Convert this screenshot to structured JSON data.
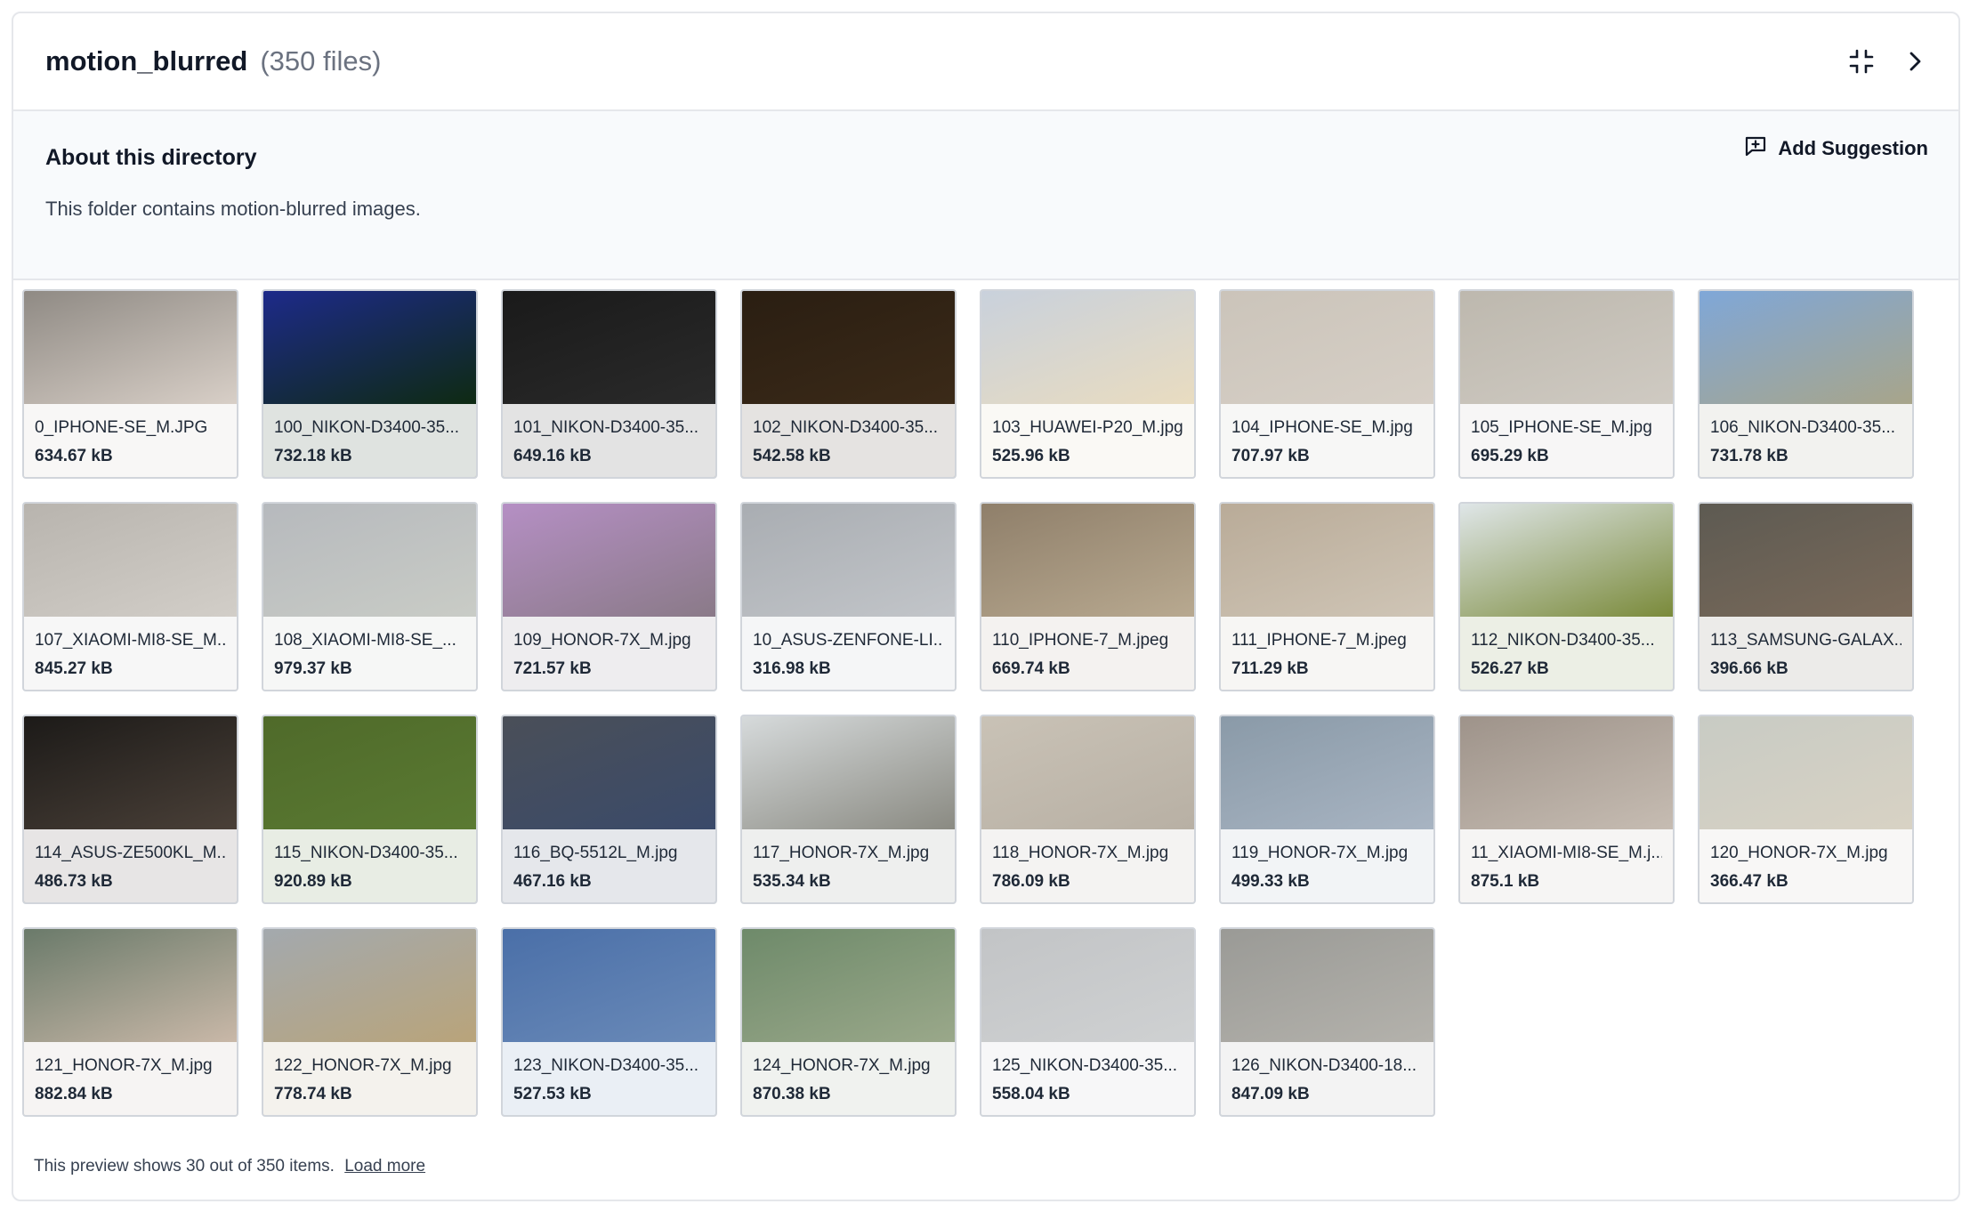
{
  "header": {
    "title": "motion_blurred",
    "count": "(350 files)",
    "collapse_icon": "collapse-icon",
    "next_icon": "chevron-right-icon"
  },
  "about": {
    "heading": "About this directory",
    "description": "This folder contains motion-blurred images.",
    "suggest_label": "Add Suggestion",
    "suggest_icon": "comment-plus-icon"
  },
  "files": [
    {
      "name": "0_IPHONE-SE_M.JPG",
      "size": "634.67 kB",
      "top": "#8f8a84",
      "bottom": "#d8cfc7"
    },
    {
      "name": "100_NIKON-D3400-35...",
      "size": "732.18 kB",
      "top": "#1d2a8a",
      "bottom": "#0e2a12"
    },
    {
      "name": "101_NIKON-D3400-35...",
      "size": "649.16 kB",
      "top": "#1a1a1a",
      "bottom": "#2a2a2a"
    },
    {
      "name": "102_NIKON-D3400-35...",
      "size": "542.58 kB",
      "top": "#2a1e12",
      "bottom": "#3b2a18"
    },
    {
      "name": "103_HUAWEI-P20_M.jpg",
      "size": "525.96 kB",
      "top": "#c9d1dc",
      "bottom": "#e9dcc0"
    },
    {
      "name": "104_IPHONE-SE_M.jpg",
      "size": "707.97 kB",
      "top": "#cbc4ba",
      "bottom": "#d6cfc6"
    },
    {
      "name": "105_IPHONE-SE_M.jpg",
      "size": "695.29 kB",
      "top": "#bdb8ae",
      "bottom": "#cfcac2"
    },
    {
      "name": "106_NIKON-D3400-35...",
      "size": "731.78 kB",
      "top": "#7fa7d8",
      "bottom": "#a8a58a"
    },
    {
      "name": "107_XIAOMI-MI8-SE_M...",
      "size": "845.27 kB",
      "top": "#b8b4ae",
      "bottom": "#d2cec8"
    },
    {
      "name": "108_XIAOMI-MI8-SE_...",
      "size": "979.37 kB",
      "top": "#b6b9bd",
      "bottom": "#c9ccc6"
    },
    {
      "name": "109_HONOR-7X_M.jpg",
      "size": "721.57 kB",
      "top": "#b58fc4",
      "bottom": "#8a7a88"
    },
    {
      "name": "10_ASUS-ZENFONE-LI...",
      "size": "316.98 kB",
      "top": "#a9adb2",
      "bottom": "#c2c5c9"
    },
    {
      "name": "110_IPHONE-7_M.jpeg",
      "size": "669.74 kB",
      "top": "#8f7f6a",
      "bottom": "#b8a990"
    },
    {
      "name": "111_IPHONE-7_M.jpeg",
      "size": "711.29 kB",
      "top": "#b9ab98",
      "bottom": "#cfc5b6"
    },
    {
      "name": "112_NIKON-D3400-35...",
      "size": "526.27 kB",
      "top": "#dfe6e8",
      "bottom": "#7a8a3a"
    },
    {
      "name": "113_SAMSUNG-GALAX...",
      "size": "396.66 kB",
      "top": "#5d5a52",
      "bottom": "#7a6a5a"
    },
    {
      "name": "114_ASUS-ZE500KL_M...",
      "size": "486.73 kB",
      "top": "#1c1a18",
      "bottom": "#4a4038"
    },
    {
      "name": "115_NIKON-D3400-35...",
      "size": "920.89 kB",
      "top": "#4f6a2a",
      "bottom": "#5a7a32"
    },
    {
      "name": "116_BQ-5512L_M.jpg",
      "size": "467.16 kB",
      "top": "#4a4f58",
      "bottom": "#3a4a6a"
    },
    {
      "name": "117_HONOR-7X_M.jpg",
      "size": "535.34 kB",
      "top": "#d6dadb",
      "bottom": "#8a8a82"
    },
    {
      "name": "118_HONOR-7X_M.jpg",
      "size": "786.09 kB",
      "top": "#c9c2b6",
      "bottom": "#b8b0a4"
    },
    {
      "name": "119_HONOR-7X_M.jpg",
      "size": "499.33 kB",
      "top": "#8a9aa8",
      "bottom": "#a8b4c2"
    },
    {
      "name": "11_XIAOMI-MI8-SE_M.j...",
      "size": "875.1 kB",
      "top": "#9e938a",
      "bottom": "#c6bcb2"
    },
    {
      "name": "120_HONOR-7X_M.jpg",
      "size": "366.47 kB",
      "top": "#c8cbc4",
      "bottom": "#d8d2c4"
    },
    {
      "name": "121_HONOR-7X_M.jpg",
      "size": "882.84 kB",
      "top": "#6a7a6a",
      "bottom": "#c9b8a8"
    },
    {
      "name": "122_HONOR-7X_M.jpg",
      "size": "778.74 kB",
      "top": "#a3a9ae",
      "bottom": "#b9a47a"
    },
    {
      "name": "123_NIKON-D3400-35...",
      "size": "527.53 kB",
      "top": "#4a6fa8",
      "bottom": "#6a8ab8"
    },
    {
      "name": "124_HONOR-7X_M.jpg",
      "size": "870.38 kB",
      "top": "#6e8a6a",
      "bottom": "#9aa88a"
    },
    {
      "name": "125_NIKON-D3400-35...",
      "size": "558.04 kB",
      "top": "#c2c4c6",
      "bottom": "#cfd1d2"
    },
    {
      "name": "126_NIKON-D3400-18...",
      "size": "847.09 kB",
      "top": "#9a9a96",
      "bottom": "#b4b2ac"
    }
  ],
  "footer": {
    "text": "This preview shows 30 out of 350 items.",
    "load_more": "Load more"
  }
}
